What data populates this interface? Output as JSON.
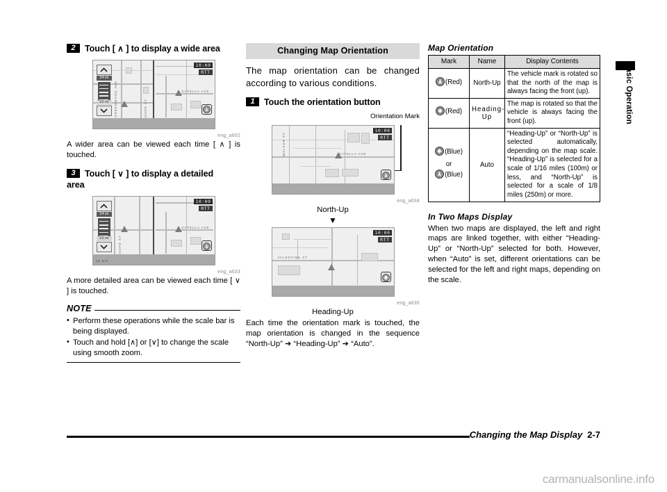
{
  "page": {
    "side_tab_label": "Basic Operation",
    "footer_title": "Changing the Map Display",
    "footer_page": "2-7",
    "watermark": "carmanualsonline.info"
  },
  "col1": {
    "step2": {
      "num": "2",
      "text_before": "Touch [",
      "icon": "chevron-up-icon",
      "text_after": "] to display a wide area",
      "figure_id": "eng_a602",
      "caption": "A wider area can be viewed each time [",
      "caption_after": "] is touched."
    },
    "step3": {
      "num": "3",
      "text_before": "Touch [",
      "icon": "chevron-down-icon",
      "text_after": "] to display a detailed",
      "text_line2": "area",
      "figure_id": "eng_a633",
      "caption": "A more detailed area can be viewed each time [",
      "caption_after": "] is touched."
    },
    "note": {
      "title": "NOTE",
      "items": [
        "Perform these operations while the scale bar is being displayed.",
        "Touch and hold [∧] or [∨] to change the scale using smooth zoom."
      ]
    }
  },
  "col2": {
    "banner": "Changing Map Orientation",
    "intro": "The map orientation can be changed according to various conditions.",
    "step1": {
      "num": "1",
      "text": "Touch the orientation button"
    },
    "callout_label": "Orientation Mark",
    "figure1_id": "eng_a634",
    "figure1_label": "North-Up",
    "arrow": "▼",
    "figure2_id": "eng_a635",
    "figure2_label": "Heading-Up",
    "closing": "Each time the orientation mark is touched, the map orientation is changed in the sequence “North-Up” ➔ “Heading-Up” ➔ “Auto”."
  },
  "col3": {
    "table_title": "Map Orientation",
    "table": {
      "headers": [
        "Mark",
        "Name",
        "Display Contents"
      ],
      "rows": [
        {
          "mark_icon": "north-up-mark-icon",
          "mark_color": "(Red)",
          "name": "North-Up",
          "desc": "The vehicle mark is rotated so that the north of the map is always facing the front (up)."
        },
        {
          "mark_icon": "heading-up-mark-icon",
          "mark_color": "(Red)",
          "name": "Heading-Up",
          "desc": "The map is rotated so that the vehicle is always facing the front (up)."
        },
        {
          "mark_icon": "heading-up-mark-icon",
          "mark_color": "(Blue)",
          "mark_or": "or",
          "mark_icon2": "north-up-mark-icon",
          "mark_color2": "(Blue)",
          "name": "Auto",
          "desc": "“Heading-Up” or “North-Up” is selected automatically, depending on the map scale. “Heading-Up” is selected for a scale of 1/16 miles (100m) or less, and “North-Up” is selected for a scale of 1/8 miles (250m) or more."
        }
      ]
    },
    "two_maps_title": "In Two Maps Display",
    "two_maps_body": "When two maps are displayed, the left and right maps are linked together, with either “Heading-Up” or “North-Up” selected for both. However, when “Auto” is set, different orientations can be selected for the left and right maps, depending on the scale."
  },
  "screens": {
    "clock": "10:00",
    "rtt": "RTT",
    "scale_top": "1/4 mi",
    "scale_bottom": "1/2 mi",
    "street_katella": "KATELLA AVE",
    "street_walker": "WALKER ST",
    "street_wood": "GREENWOOD AVE",
    "street_hope": "HOPE ST",
    "street_valentine": "VALENTINE ST",
    "scale_label": "15 3/4"
  }
}
